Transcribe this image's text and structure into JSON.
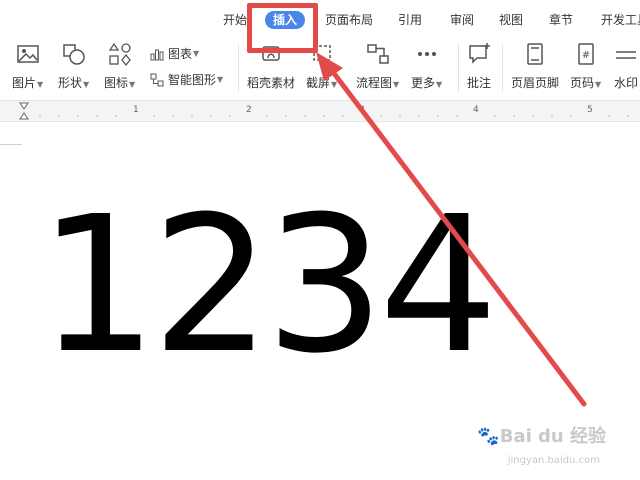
{
  "tabs": [
    {
      "label": "开始",
      "active": false
    },
    {
      "label": "插入",
      "active": true
    },
    {
      "label": "页面布局",
      "active": false
    },
    {
      "label": "引用",
      "active": false
    },
    {
      "label": "审阅",
      "active": false
    },
    {
      "label": "视图",
      "active": false
    },
    {
      "label": "章节",
      "active": false
    },
    {
      "label": "开发工具",
      "active": false
    }
  ],
  "toolbar": {
    "picture": "图片",
    "shape": "形状",
    "icon": "图标",
    "chart": "图表",
    "smart_graphic": "智能图形",
    "straw_material": "稻壳素材",
    "screenshot": "截屏",
    "flowchart": "流程图",
    "more": "更多",
    "comment": "批注",
    "header_footer": "页眉页脚",
    "page_number": "页码",
    "watermark": "水印"
  },
  "ruler": {
    "marks": [
      "1",
      "2",
      "3",
      "4",
      "5"
    ]
  },
  "document": {
    "text": "1234"
  },
  "accent_colors": {
    "active_tab": "#4a86e8",
    "annotation": "#e34b4b"
  },
  "brand_watermark": {
    "text": "Bai du 经验",
    "url": "jingyan.baidu.com"
  }
}
